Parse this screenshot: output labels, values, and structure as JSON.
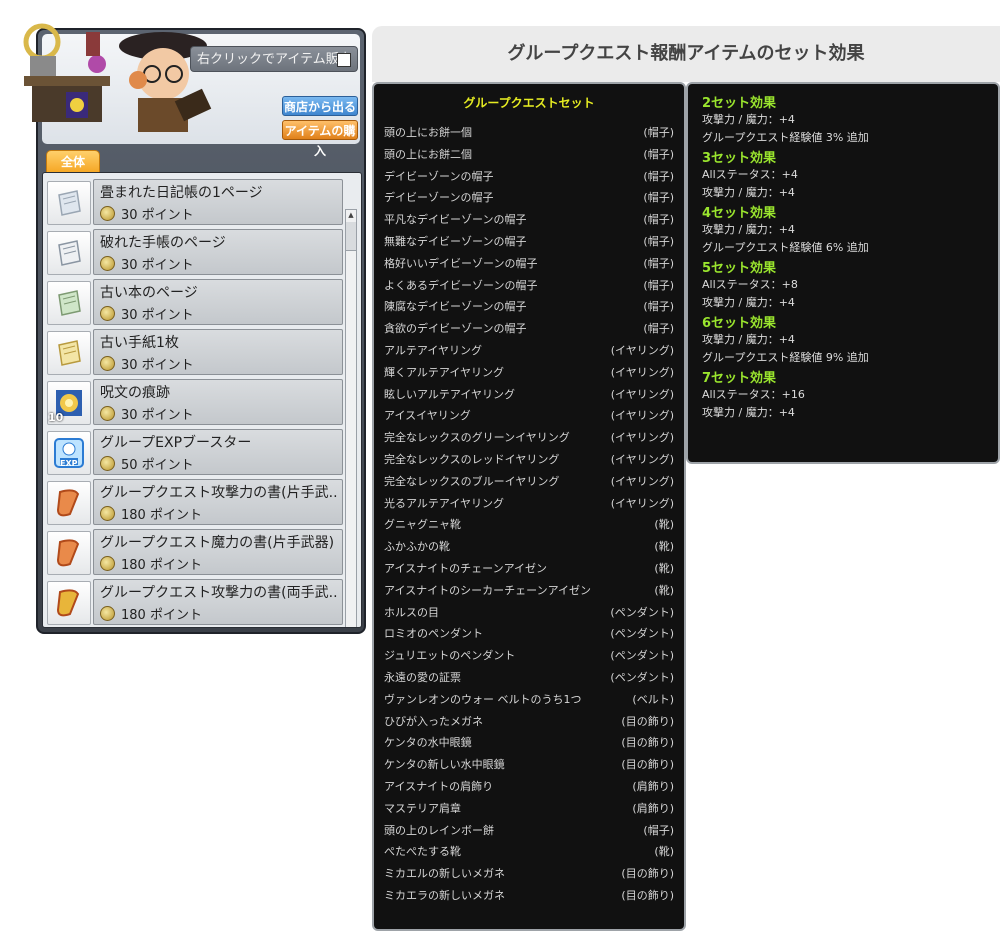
{
  "shop": {
    "sell_toggle_label": "右クリックでアイテム販売",
    "exit_button": "商店から出る",
    "buy_button": "アイテムの購入",
    "tab_label": "全体",
    "items": [
      {
        "name": "畳まれた日記帳の1ページ",
        "price": "30 ポイント",
        "icon": "folded-page-icon"
      },
      {
        "name": "破れた手帳のページ",
        "price": "30 ポイント",
        "icon": "torn-page-icon"
      },
      {
        "name": "古い本のページ",
        "price": "30 ポイント",
        "icon": "old-book-page-icon"
      },
      {
        "name": "古い手紙1枚",
        "price": "30 ポイント",
        "icon": "old-letter-icon"
      },
      {
        "name": "呪文の痕跡",
        "price": "30 ポイント",
        "icon": "spell-trace-icon",
        "badge": "10"
      },
      {
        "name": "グループEXPブースター",
        "price": "50 ポイント",
        "icon": "exp-booster-icon",
        "badge_text": "EXP"
      },
      {
        "name": "グループクエスト攻撃力の書(片手武...",
        "price": "180 ポイント",
        "icon": "scroll-icon"
      },
      {
        "name": "グループクエスト魔力の書(片手武器)",
        "price": "180 ポイント",
        "icon": "scroll-icon"
      },
      {
        "name": "グループクエスト攻撃力の書(両手武...",
        "price": "180 ポイント",
        "icon": "scroll-icon"
      }
    ]
  },
  "panel": {
    "header": "グループクエスト報酬アイテムのセット効果",
    "set_title": "グループクエストセット",
    "set_items": [
      {
        "name": "頭の上にお餅一個",
        "category": "(帽子)"
      },
      {
        "name": "頭の上にお餅二個",
        "category": "(帽子)"
      },
      {
        "name": "デイビーゾーンの帽子",
        "category": "(帽子)"
      },
      {
        "name": "デイビーゾーンの帽子",
        "category": "(帽子)"
      },
      {
        "name": "平凡なデイビーゾーンの帽子",
        "category": "(帽子)"
      },
      {
        "name": "無難なデイビーゾーンの帽子",
        "category": "(帽子)"
      },
      {
        "name": "格好いいデイビーゾーンの帽子",
        "category": "(帽子)"
      },
      {
        "name": "よくあるデイビーゾーンの帽子",
        "category": "(帽子)"
      },
      {
        "name": "陳腐なデイビーゾーンの帽子",
        "category": "(帽子)"
      },
      {
        "name": "貪欲のデイビーゾーンの帽子",
        "category": "(帽子)"
      },
      {
        "name": "アルテアイヤリング",
        "category": "(イヤリング)"
      },
      {
        "name": "輝くアルテアイヤリング",
        "category": "(イヤリング)"
      },
      {
        "name": "眩しいアルテアイヤリング",
        "category": "(イヤリング)"
      },
      {
        "name": "アイスイヤリング",
        "category": "(イヤリング)"
      },
      {
        "name": "完全なレックスのグリーンイヤリング",
        "category": "(イヤリング)"
      },
      {
        "name": "完全なレックスのレッドイヤリング",
        "category": "(イヤリング)"
      },
      {
        "name": "完全なレックスのブルーイヤリング",
        "category": "(イヤリング)"
      },
      {
        "name": "光るアルテアイヤリング",
        "category": "(イヤリング)"
      },
      {
        "name": "グニャグニャ靴",
        "category": "(靴)"
      },
      {
        "name": "ふかふかの靴",
        "category": "(靴)"
      },
      {
        "name": "アイスナイトのチェーンアイゼン",
        "category": "(靴)"
      },
      {
        "name": "アイスナイトのシーカーチェーンアイゼン",
        "category": "(靴)"
      },
      {
        "name": "ホルスの目",
        "category": "(ペンダント)"
      },
      {
        "name": "ロミオのペンダント",
        "category": "(ペンダント)"
      },
      {
        "name": "ジュリエットのペンダント",
        "category": "(ペンダント)"
      },
      {
        "name": "永遠の愛の証票",
        "category": "(ペンダント)"
      },
      {
        "name": "ヴァンレオンのウォー ベルトのうち1つ",
        "category": "(ベルト)"
      },
      {
        "name": "ひびが入ったメガネ",
        "category": "(目の飾り)"
      },
      {
        "name": "ケンタの水中眼鏡",
        "category": "(目の飾り)"
      },
      {
        "name": "ケンタの新しい水中眼鏡",
        "category": "(目の飾り)"
      },
      {
        "name": "アイスナイトの肩飾り",
        "category": "(肩飾り)"
      },
      {
        "name": "マステリア肩章",
        "category": "(肩飾り)"
      },
      {
        "name": "頭の上のレインボー餅",
        "category": "(帽子)"
      },
      {
        "name": "ぺたぺたする靴",
        "category": "(靴)"
      },
      {
        "name": "ミカエルの新しいメガネ",
        "category": "(目の飾り)"
      },
      {
        "name": "ミカエラの新しいメガネ",
        "category": "(目の飾り)"
      }
    ],
    "effects": [
      {
        "title": "2セット効果",
        "lines": [
          "攻撃力 / 魔力：+4",
          "グループクエスト経験値 3% 追加"
        ]
      },
      {
        "title": "3セット効果",
        "lines": [
          "Allステータス：+4",
          "攻撃力 / 魔力：+4"
        ]
      },
      {
        "title": "4セット効果",
        "lines": [
          "攻撃力 / 魔力：+4",
          "グループクエスト経験値 6% 追加"
        ]
      },
      {
        "title": "5セット効果",
        "lines": [
          "Allステータス：+8",
          "攻撃力 / 魔力：+4"
        ]
      },
      {
        "title": "6セット効果",
        "lines": [
          "攻撃力 / 魔力：+4",
          "グループクエスト経験値 9% 追加"
        ]
      },
      {
        "title": "7セット効果",
        "lines": [
          "Allステータス：+16",
          "攻撃力 / 魔力：+4"
        ]
      }
    ]
  },
  "colors": {
    "effect_title": "#9ae52e",
    "set_title": "#e6ec22",
    "panel_bg": "#111111"
  }
}
